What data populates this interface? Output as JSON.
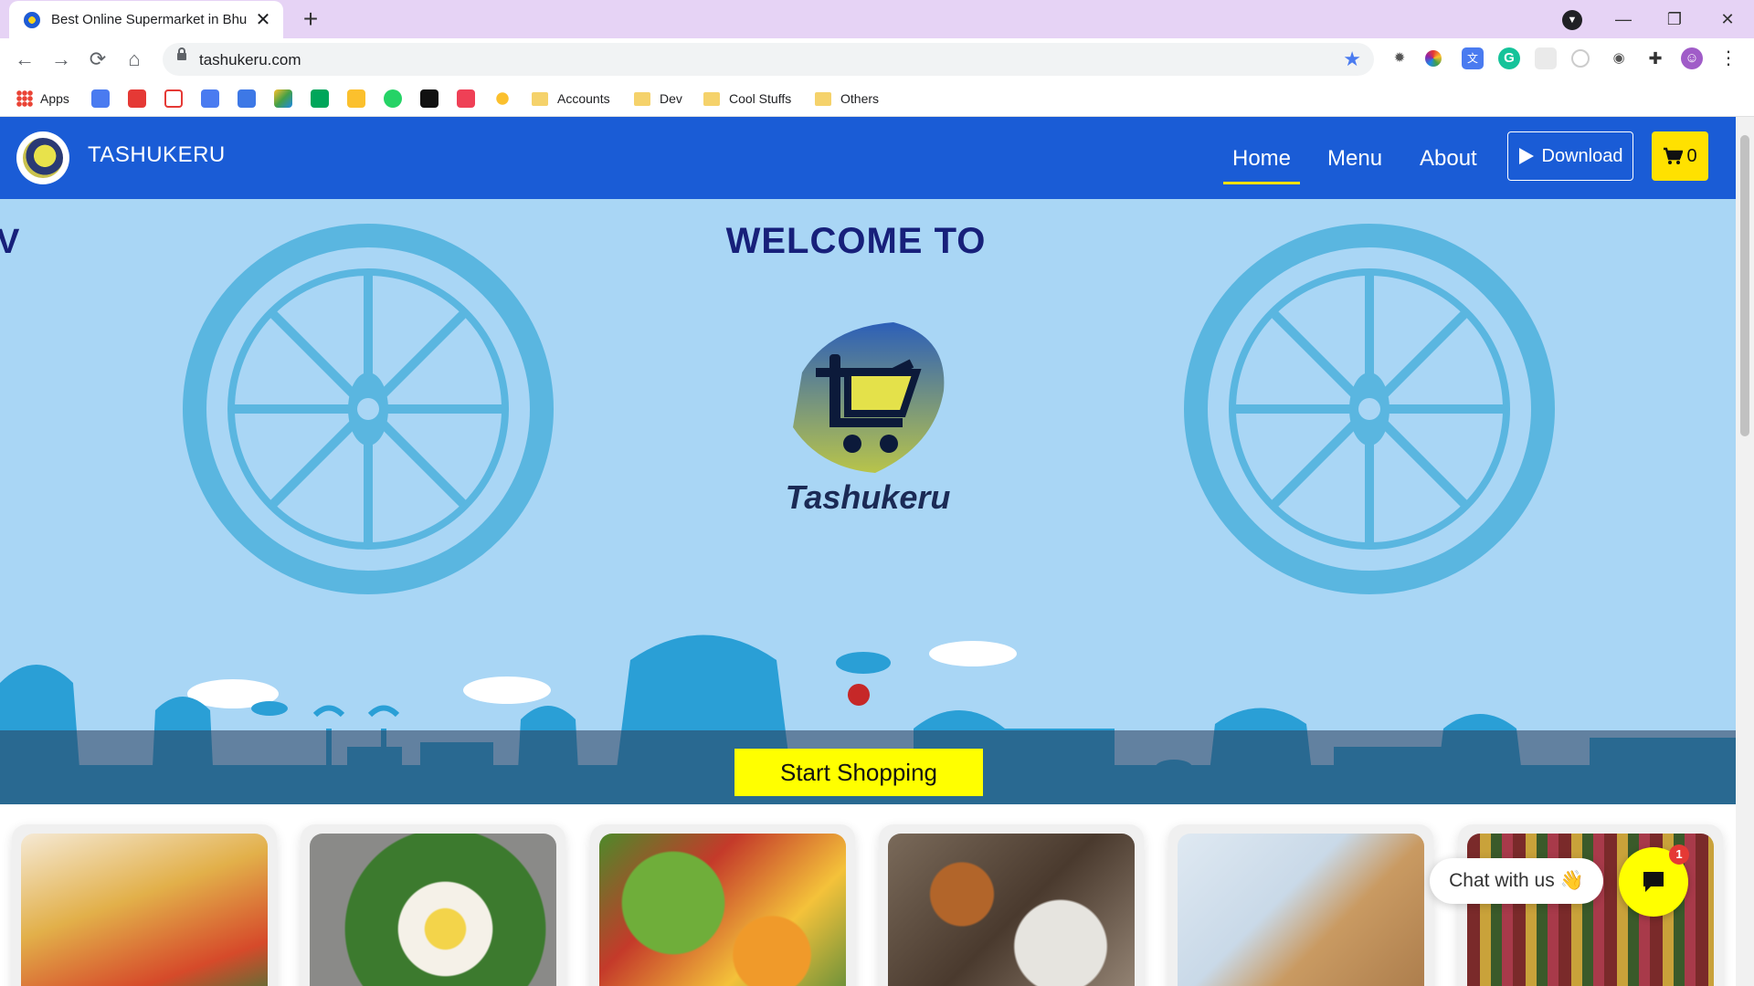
{
  "browser": {
    "tab_title": "Best Online Supermarket in Bhub",
    "url": "tashukeru.com",
    "bookmarks": {
      "apps": "Apps",
      "folders": [
        "Accounts",
        "Dev",
        "Cool Stuffs",
        "Others"
      ]
    }
  },
  "site": {
    "brand": "TASHUKERU",
    "nav": {
      "home": "Home",
      "menu": "Menu",
      "about": "About",
      "download": "Download",
      "cart_count": "0"
    },
    "hero": {
      "title": "WELCOME TO",
      "edge_text": "V",
      "logo_text": "Tashukeru",
      "cta": "Start Shopping"
    },
    "chat": {
      "label": "Chat with us",
      "emoji": "👋",
      "badge": "1"
    }
  },
  "colors": {
    "nav_bg": "#1a5cd6",
    "hero_bg": "#a9d6f5",
    "accent_yellow": "#ffff00",
    "title_navy": "#17207a"
  }
}
